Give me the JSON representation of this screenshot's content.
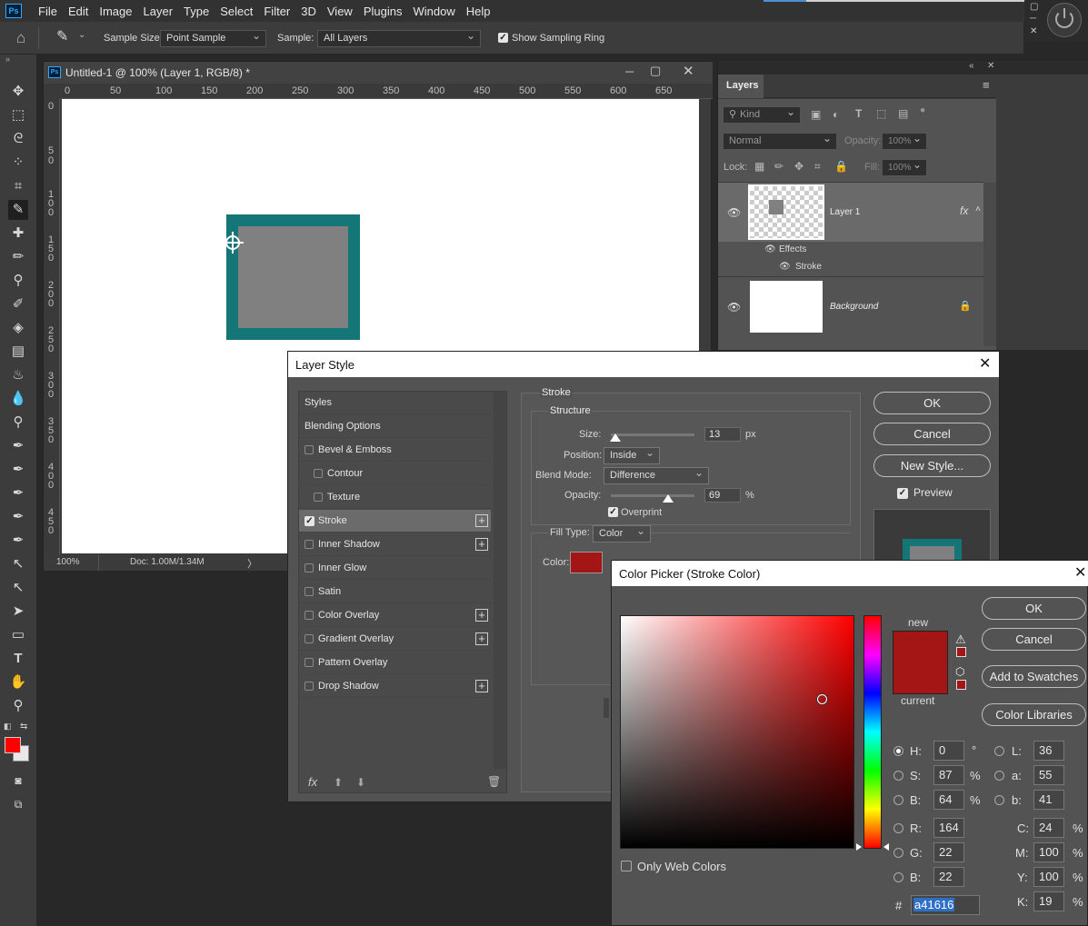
{
  "menu": [
    "File",
    "Edit",
    "Image",
    "Layer",
    "Type",
    "Select",
    "Filter",
    "3D",
    "View",
    "Plugins",
    "Window",
    "Help"
  ],
  "app_logo": "Ps",
  "options": {
    "sample_size_label": "Sample Size:",
    "sample_size_value": "Point Sample",
    "sample_label": "Sample:",
    "sample_value": "All Layers",
    "show_ring_label": "Show Sampling Ring"
  },
  "document": {
    "title": "Untitled-1 @ 100% (Layer 1, RGB/8) *",
    "ruler_h": [
      "0",
      "50",
      "100",
      "150",
      "200",
      "250",
      "300",
      "350",
      "400",
      "450",
      "500",
      "550",
      "600",
      "650"
    ],
    "ruler_v": [
      "0",
      "50",
      "100",
      "150",
      "200",
      "250",
      "300",
      "350",
      "400",
      "450"
    ],
    "zoom": "100%",
    "doc_size": "Doc: 1.00M/1.34M"
  },
  "layers": {
    "tab": "Layers",
    "kind": "Kind",
    "blend": "Normal",
    "opacity_label": "Opacity:",
    "opacity_value": "100%",
    "lock_label": "Lock:",
    "fill_label": "Fill:",
    "fill_value": "100%",
    "layer1": "Layer 1",
    "fx": "fx",
    "effects": "Effects",
    "stroke": "Stroke",
    "background": "Background"
  },
  "layer_style": {
    "title": "Layer Style",
    "items": [
      {
        "label": "Styles",
        "check": "none",
        "plus": false
      },
      {
        "label": "Blending Options",
        "check": "none",
        "plus": false
      },
      {
        "label": "Bevel & Emboss",
        "check": "off",
        "plus": false
      },
      {
        "label": "Contour",
        "check": "off",
        "plus": false,
        "indent": true
      },
      {
        "label": "Texture",
        "check": "off",
        "plus": false,
        "indent": true
      },
      {
        "label": "Stroke",
        "check": "on",
        "plus": true,
        "selected": true
      },
      {
        "label": "Inner Shadow",
        "check": "off",
        "plus": true
      },
      {
        "label": "Inner Glow",
        "check": "off",
        "plus": false
      },
      {
        "label": "Satin",
        "check": "off",
        "plus": false
      },
      {
        "label": "Color Overlay",
        "check": "off",
        "plus": true
      },
      {
        "label": "Gradient Overlay",
        "check": "off",
        "plus": true
      },
      {
        "label": "Pattern Overlay",
        "check": "off",
        "plus": false
      },
      {
        "label": "Drop Shadow",
        "check": "off",
        "plus": true
      }
    ],
    "stroke_header": "Stroke",
    "structure_header": "Structure",
    "size_label": "Size:",
    "size_value": "13",
    "size_unit": "px",
    "position_label": "Position:",
    "position_value": "Inside",
    "blend_label": "Blend Mode:",
    "blend_value": "Difference",
    "opacity_label": "Opacity:",
    "opacity_value": "69",
    "opacity_unit": "%",
    "overprint_label": "Overprint",
    "fill_type_label": "Fill Type:",
    "fill_type_value": "Color",
    "color_label": "Color:",
    "ok": "OK",
    "cancel": "Cancel",
    "new_style": "New Style...",
    "preview": "Preview",
    "size_slider": 0.05,
    "opacity_slider": 0.69
  },
  "color_picker": {
    "title": "Color Picker (Stroke Color)",
    "ok": "OK",
    "cancel": "Cancel",
    "add_swatches": "Add to Swatches",
    "color_libraries": "Color Libraries",
    "new_label": "new",
    "current_label": "current",
    "only_web": "Only Web Colors",
    "hex_label": "#",
    "hex": "a41616",
    "H": "0",
    "S": "87",
    "B": "64",
    "R": "164",
    "G": "22",
    "Bv": "22",
    "L": "36",
    "a": "55",
    "b": "41",
    "C": "24",
    "M": "100",
    "Y": "100",
    "K": "19",
    "deg": "°",
    "pct": "%"
  },
  "colors": {
    "stroke": "#a41616",
    "teal": "#147676",
    "gray_fill": "#808080",
    "foreground": "#ff0000"
  }
}
